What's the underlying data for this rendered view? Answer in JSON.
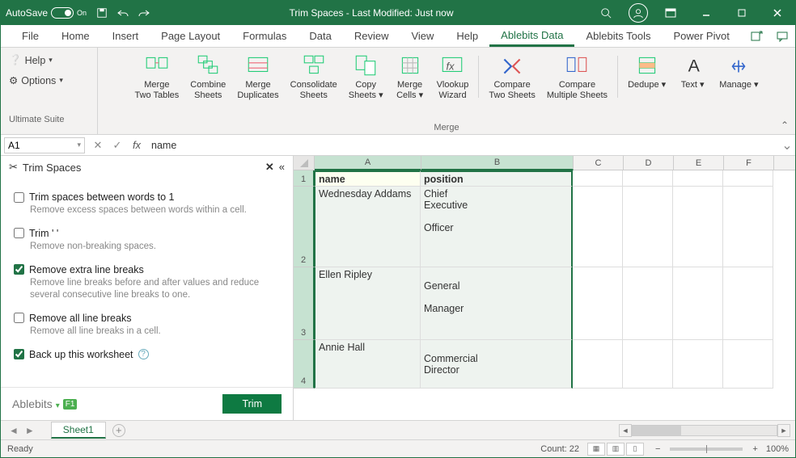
{
  "titlebar": {
    "autosave": "AutoSave",
    "autosave_state": "On",
    "doc_title": "Trim Spaces - Last Modified: Just now"
  },
  "menu": {
    "items": [
      "File",
      "Home",
      "Insert",
      "Page Layout",
      "Formulas",
      "Data",
      "Review",
      "View",
      "Help",
      "Ablebits Data",
      "Ablebits Tools",
      "Power Pivot"
    ],
    "active": "Ablebits Data"
  },
  "ribbon_left": {
    "help": "Help",
    "options": "Options",
    "suite": "Ultimate Suite"
  },
  "ribbon": {
    "group_merge_label": "Merge",
    "buttons": [
      {
        "line1": "Merge",
        "line2": "Two Tables"
      },
      {
        "line1": "Combine",
        "line2": "Sheets"
      },
      {
        "line1": "Merge",
        "line2": "Duplicates"
      },
      {
        "line1": "Consolidate",
        "line2": "Sheets"
      },
      {
        "line1": "Copy",
        "line2": "Sheets",
        "caret": true
      },
      {
        "line1": "Merge",
        "line2": "Cells",
        "caret": true
      },
      {
        "line1": "Vlookup",
        "line2": "Wizard"
      },
      {
        "line1": "Compare",
        "line2": "Two Sheets"
      },
      {
        "line1": "Compare",
        "line2": "Multiple Sheets"
      },
      {
        "line1": "Dedupe",
        "line2": "",
        "caret": true
      },
      {
        "line1": "Text",
        "line2": "",
        "caret": true
      },
      {
        "line1": "Manage",
        "line2": "",
        "caret": true
      }
    ]
  },
  "formula": {
    "name_box": "A1",
    "value": "name"
  },
  "pane": {
    "title": "Trim Spaces",
    "options": [
      {
        "label": "Trim spaces between words to 1",
        "sub": "Remove excess spaces between words within a cell.",
        "checked": false
      },
      {
        "label": "Trim '&nbsp;'",
        "sub": "Remove non-breaking spaces.",
        "checked": false
      },
      {
        "label": "Remove extra line breaks",
        "sub": "Remove line breaks before and after values and reduce several consecutive line breaks to one.",
        "checked": true
      },
      {
        "label": "Remove all line breaks",
        "sub": "Remove all line breaks in a cell.",
        "checked": false
      },
      {
        "label": "Back up this worksheet",
        "sub": "",
        "checked": true,
        "help": true
      }
    ],
    "brand": "Ablebits",
    "f1": "F1",
    "trim_button": "Trim"
  },
  "grid": {
    "cols": [
      "A",
      "B",
      "C",
      "D",
      "E",
      "F"
    ],
    "rows": [
      {
        "num": "1",
        "h": 20,
        "a": "name",
        "b": "position"
      },
      {
        "num": "2",
        "h": 100,
        "a": "Wednesday Addams",
        "b": "Chief\nExecutive\n\nOfficer"
      },
      {
        "num": "3",
        "h": 90,
        "a": "Ellen Ripley",
        "b": "\nGeneral\n\nManager"
      },
      {
        "num": "4",
        "h": 60,
        "a": "Annie Hall",
        "b": "\nCommercial\nDirector"
      }
    ]
  },
  "tabs": {
    "sheet": "Sheet1"
  },
  "status": {
    "ready": "Ready",
    "count": "Count: 22",
    "zoom": "100%"
  }
}
